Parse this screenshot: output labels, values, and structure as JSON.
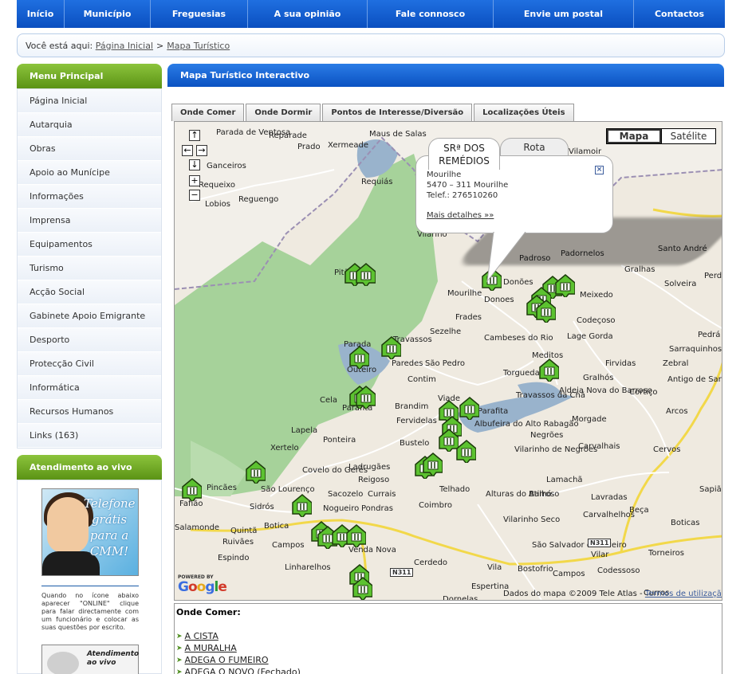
{
  "nav": [
    "Início",
    "Município",
    "Freguesias",
    "A sua opinião",
    "Fale connosco",
    "Envie um postal",
    "Contactos"
  ],
  "breadcrumb": {
    "prefix": "Você está aqui:",
    "items": [
      "Página Inicial",
      "Mapa Turístico"
    ]
  },
  "sidebar": {
    "menu_title": "Menu Principal",
    "items": [
      "Página Inicial",
      "Autarquia",
      "Obras",
      "Apoio ao Munícipe",
      "Informações",
      "Imprensa",
      "Equipamentos",
      "Turismo",
      "Acção Social",
      "Gabinete Apoio Emigrante",
      "Desporto",
      "Protecção Civil",
      "Informática",
      "Recursos Humanos",
      "Links (163)"
    ],
    "live_title": "Atendimento ao vivo",
    "promo_text": "Telefone grátis para a CMM!",
    "live_text": "Quando no ícone abaixo aparecer \"ONLINE\" clique para falar directamente com um funcionário e colocar as suas questões por escrito.",
    "live_button": "Atendimento ao vivo"
  },
  "main": {
    "title": "Mapa Turístico Interactivo",
    "tabs": [
      "Onde Comer",
      "Onde Dormir",
      "Pontos de Interesse/Diversão",
      "Localizações Úteis"
    ]
  },
  "map": {
    "map_types": [
      "Mapa",
      "Satélite"
    ],
    "active_type": "Mapa",
    "places": [
      [
        "Parada de Ventosa",
        52,
        8
      ],
      [
        "Reparade",
        118,
        12
      ],
      [
        "Prado",
        154,
        26
      ],
      [
        "Xermeade",
        192,
        24
      ],
      [
        "Maus de Salas",
        244,
        10
      ],
      [
        "Ganceiros",
        40,
        50
      ],
      [
        "Requeixo",
        30,
        74
      ],
      [
        "Requiás",
        234,
        70
      ],
      [
        "Reguengo",
        80,
        92
      ],
      [
        "Lobios",
        38,
        98
      ],
      [
        "Vilarino",
        304,
        136
      ],
      [
        "Vilamoir",
        494,
        32
      ],
      [
        "Pitões",
        200,
        184
      ],
      [
        "Padroso",
        432,
        166
      ],
      [
        "Padornelos",
        484,
        160
      ],
      [
        "Gralhas",
        564,
        180
      ],
      [
        "Santo André",
        606,
        154
      ],
      [
        "Solveira",
        614,
        198
      ],
      [
        "Perd",
        664,
        188
      ],
      [
        "Mourilhe",
        342,
        210
      ],
      [
        "Donoes",
        388,
        218
      ],
      [
        "Donões",
        412,
        196
      ],
      [
        "Meixedo",
        508,
        212
      ],
      [
        "Frades",
        352,
        240
      ],
      [
        "Codeçoso",
        504,
        244
      ],
      [
        "Sezelhe",
        320,
        258
      ],
      [
        "Cambeses do Rio",
        388,
        266
      ],
      [
        "Lage Gorda",
        492,
        264
      ],
      [
        "Pedrá",
        656,
        262
      ],
      [
        "Sarraquinhos",
        620,
        280
      ],
      [
        "Parada",
        212,
        274
      ],
      [
        "Travassos",
        274,
        268
      ],
      [
        "Outeiro",
        216,
        306
      ],
      [
        "Paredes",
        272,
        298
      ],
      [
        "São Pedro",
        314,
        298
      ],
      [
        "Meditos",
        448,
        288
      ],
      [
        "Firvidas",
        540,
        298
      ],
      [
        "Zebral",
        612,
        298
      ],
      [
        "Torgueda",
        412,
        310
      ],
      [
        "Gralhós",
        512,
        316
      ],
      [
        "Antigo de Sarraquinhos",
        618,
        318
      ],
      [
        "Contim",
        292,
        318
      ],
      [
        "Cela",
        182,
        344
      ],
      [
        "Parafita",
        210,
        354
      ],
      [
        "Brandim",
        276,
        352
      ],
      [
        "Viade",
        330,
        342
      ],
      [
        "Travassos da Chã",
        428,
        338
      ],
      [
        "Aldeia Nova do Barroso",
        482,
        332
      ],
      [
        "Cortiço",
        570,
        334
      ],
      [
        "Fervidelas",
        278,
        370
      ],
      [
        "Parafita",
        380,
        358
      ],
      [
        "Arcos",
        616,
        358
      ],
      [
        "Morgade",
        498,
        368
      ],
      [
        "Lapela",
        146,
        382
      ],
      [
        "Ponteira",
        186,
        394
      ],
      [
        "Bustelo",
        282,
        398
      ],
      [
        "Albufeira do Alto Rabagão",
        376,
        374
      ],
      [
        "Negrões",
        446,
        388
      ],
      [
        "Xertelo",
        120,
        404
      ],
      [
        "Vilarinho de Negrões",
        426,
        406
      ],
      [
        "Carvalhais",
        506,
        402
      ],
      [
        "Cervos",
        600,
        406
      ],
      [
        "Covelo do Gerês",
        160,
        432
      ],
      [
        "Ladrugães",
        218,
        428
      ],
      [
        "Reigoso",
        230,
        444
      ],
      [
        "Lamachã",
        466,
        444
      ],
      [
        "Pincães",
        40,
        454
      ],
      [
        "São Lourenço",
        108,
        456
      ],
      [
        "Sacozelo",
        192,
        462
      ],
      [
        "Currais",
        242,
        462
      ],
      [
        "Telhado",
        332,
        456
      ],
      [
        "Atilhó",
        444,
        462
      ],
      [
        "Lavradas",
        522,
        466
      ],
      [
        "Sapiã",
        658,
        456
      ],
      [
        "Fafião",
        6,
        474
      ],
      [
        "Sidrós",
        94,
        478
      ],
      [
        "Nogueiro",
        186,
        480
      ],
      [
        "Pondras",
        234,
        480
      ],
      [
        "Coimbro",
        306,
        476
      ],
      [
        "Alturas do Barroso",
        390,
        462
      ],
      [
        "Beça",
        570,
        482
      ],
      [
        "Carvalhelhos",
        512,
        488
      ],
      [
        "Salamonde",
        0,
        504
      ],
      [
        "Quintã",
        70,
        508
      ],
      [
        "Botica",
        112,
        502
      ],
      [
        "Vilarinho Seco",
        412,
        494
      ],
      [
        "Boticas",
        622,
        498
      ],
      [
        "Ruivães",
        60,
        522
      ],
      [
        "Campos",
        122,
        526
      ],
      [
        "São Salvador de Viveiro",
        448,
        526
      ],
      [
        "Torneiros",
        594,
        536
      ],
      [
        "Vilar",
        522,
        538
      ],
      [
        "Espindo",
        54,
        542
      ],
      [
        "Venda Nova",
        218,
        532
      ],
      [
        "Linharelhos",
        138,
        554
      ],
      [
        "Cerdedo",
        300,
        548
      ],
      [
        "Vila",
        392,
        554
      ],
      [
        "Bostofrio",
        430,
        556
      ],
      [
        "Campos",
        474,
        562
      ],
      [
        "Codessoso",
        530,
        558
      ],
      [
        "Espertina",
        372,
        578
      ],
      [
        "Dornelas",
        336,
        594
      ],
      [
        "Curros",
        588,
        586
      ]
    ],
    "roads": [
      "N311",
      "N311"
    ],
    "info_window": {
      "tab1": "SRª DOS REMÉDIOS",
      "tab2": "Rota",
      "lines": [
        "Mourilhe",
        "5470 – 311 Mourilhe",
        "Telef.: 276510260"
      ],
      "more": "Mais detalhes »»"
    },
    "powered_by": "POWERED BY",
    "google": "Google",
    "copyright": "Dados do mapa ©2009 Tele Atlas -",
    "terms": "Termos de utilização",
    "zoom_labels": [
      "↑",
      "←",
      "→",
      "↓",
      "+",
      "−"
    ]
  },
  "list": {
    "title": "Onde Comer:",
    "items": [
      "A CISTA",
      "A MURALHA",
      "ADEGA O FUMEIRO",
      "ADEGA O NOVO (Fechado)"
    ]
  }
}
